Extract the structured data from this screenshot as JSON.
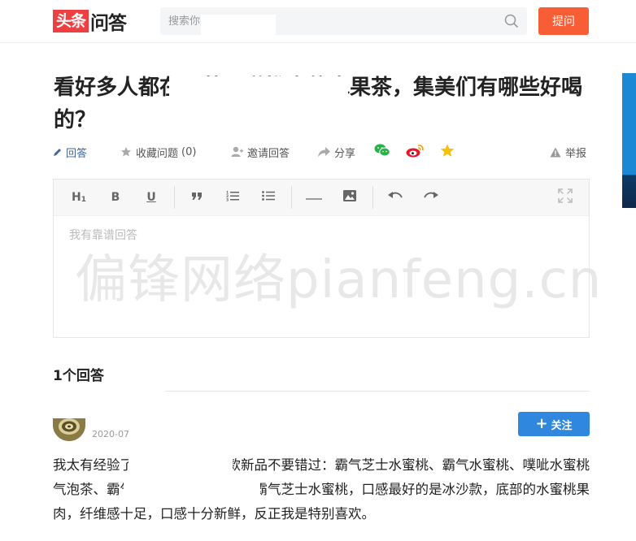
{
  "header": {
    "logo_red": "头条",
    "logo_text": "问答",
    "search_placeholder": "搜索你感兴趣的问题",
    "ask_label": "提问"
  },
  "question": {
    "title": "看好多人都在喝茶百道推出的水果茶，集美们有哪些好喝的？"
  },
  "actions": {
    "answer": "回答",
    "collect": "收藏问题",
    "collect_count": "(0)",
    "invite": "邀请回答",
    "share": "分享",
    "report": "举报"
  },
  "editor": {
    "placeholder": "我有靠谱回答",
    "tools": {
      "heading": "H",
      "bold": "B",
      "underline": "U"
    }
  },
  "watermark": "偏锋网络pianfeng.cn",
  "answers_count": "1个回答",
  "answer": {
    "date": "2020-07-",
    "follow_label": "关注",
    "text": "我太有经验了，强烈推荐这几款新品不要错过：霸气芝士水蜜桃、霸气水蜜桃、噗呲水蜜桃气泡茶、霸气葡萄气泡茶，尤其是霸气芝士水蜜桃，口感最好的是冰沙款，底部的水蜜桃果肉，纤维感十足，口感十分新鲜，反正我是特别喜欢。"
  },
  "colors": {
    "brand_red": "#ed4040",
    "ask_orange": "#f85e36",
    "follow_blue": "#2f88dd"
  }
}
